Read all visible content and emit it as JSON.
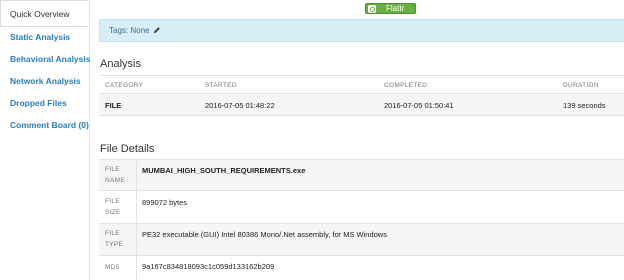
{
  "sidebar": {
    "active": "Quick Overview",
    "items": [
      {
        "label": "Static Analysis"
      },
      {
        "label": "Behavioral Analysis"
      },
      {
        "label": "Network Analysis"
      },
      {
        "label": "Dropped Files"
      },
      {
        "label": "Comment Board (0)"
      }
    ]
  },
  "flattr": {
    "label": "Flattr",
    "icon": "flattr-icon"
  },
  "tags": {
    "text": "Tags: None",
    "icon": "pencil-icon"
  },
  "analysis": {
    "title": "Analysis",
    "headers": [
      "CATEGORY",
      "STARTED",
      "COMPLETED",
      "DURATION"
    ],
    "row": [
      "FILE",
      "2016-07-05 01:48:22",
      "2016-07-05 01:50:41",
      "139 seconds"
    ]
  },
  "file_details": {
    "title": "File Details",
    "rows": [
      {
        "label_line1": "FILE",
        "label_line2": "NAME",
        "value": "MUMBAI_HIGH_SOUTH_REQUIREMENTS.exe"
      },
      {
        "label_line1": "FILE",
        "label_line2": "SIZE",
        "value": "899072 bytes"
      },
      {
        "label_line1": "FILE",
        "label_line2": "TYPE",
        "value": "PE32 executable (GUI) Intel 80386 Mono/.Net assembly, for MS Windows"
      },
      {
        "label_line1": "MD5",
        "label_line2": "",
        "value": "9a167c834818093c1c059d133162b209"
      }
    ]
  },
  "colors": {
    "link": "#2a7db5",
    "info_bg": "#d9edf7",
    "flattr_green": "#67b043"
  }
}
